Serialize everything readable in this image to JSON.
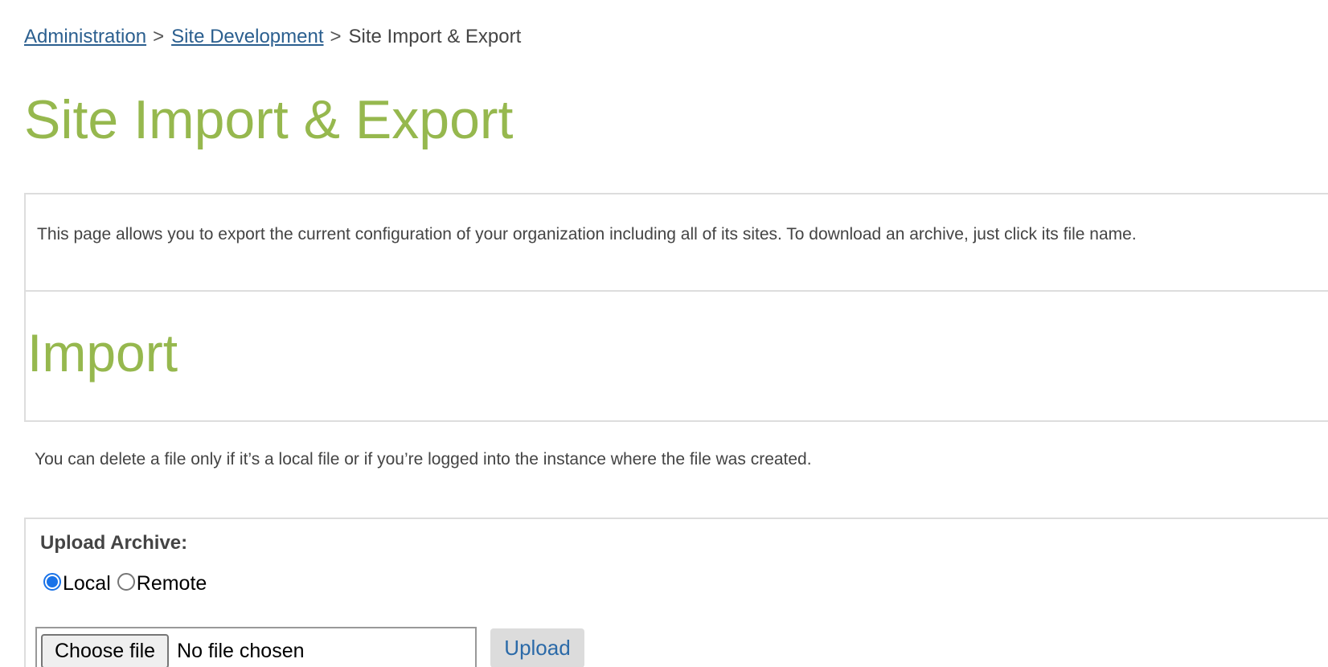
{
  "breadcrumb": {
    "items": [
      {
        "label": "Administration"
      },
      {
        "label": "Site Development"
      }
    ],
    "separator": ">",
    "current": "Site Import & Export"
  },
  "page": {
    "title": "Site Import & Export",
    "info_text": "This page allows you to export the current configuration of your organization including all of its sites. To download an archive, just click its file name."
  },
  "import_section": {
    "title": "Import",
    "note": "You can delete a file only if it’s a local file or if you’re logged into the instance where the file was created."
  },
  "upload": {
    "label": "Upload Archive:",
    "options": [
      {
        "label": "Local",
        "selected": true
      },
      {
        "label": "Remote",
        "selected": false
      }
    ],
    "choose_file_label": "Choose file",
    "file_status": "No file chosen",
    "upload_label": "Upload"
  },
  "colors": {
    "accent_green": "#96b84e",
    "link_blue": "#2b5f8f",
    "radio_selected": "#1a73e8"
  }
}
